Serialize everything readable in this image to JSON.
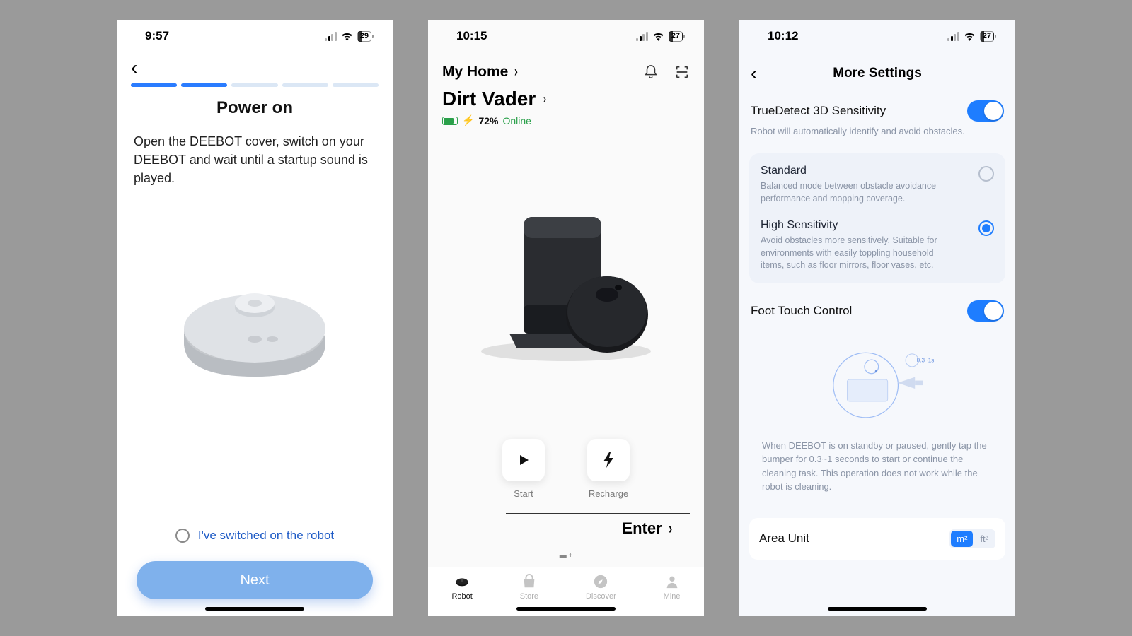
{
  "screen1": {
    "status": {
      "time": "9:57",
      "battery": "29"
    },
    "progress_total": 5,
    "progress_done": 2,
    "title": "Power on",
    "body": "Open the DEEBOT cover, switch on your DEEBOT and wait until a startup sound is played.",
    "checkbox_label": "I've switched on the robot",
    "next_label": "Next"
  },
  "screen2": {
    "status": {
      "time": "10:15",
      "battery": "27"
    },
    "home_label": "My Home",
    "device_name": "Dirt Vader",
    "battery_pct": "72%",
    "charging_prefix": "⚡",
    "online_label": "Online",
    "buttons": {
      "start": "Start",
      "recharge": "Recharge"
    },
    "enter_label": "Enter",
    "tabs": [
      {
        "id": "robot",
        "label": "Robot",
        "active": true
      },
      {
        "id": "store",
        "label": "Store",
        "active": false
      },
      {
        "id": "discover",
        "label": "Discover",
        "active": false
      },
      {
        "id": "mine",
        "label": "Mine",
        "active": false
      }
    ]
  },
  "screen3": {
    "status": {
      "time": "10:12",
      "battery": "27"
    },
    "title": "More Settings",
    "truedetect": {
      "label": "TrueDetect 3D Sensitivity",
      "sub": "Robot will automatically identify and avoid obstacles.",
      "options": [
        {
          "title": "Standard",
          "desc": "Balanced mode between obstacle avoidance performance and mopping coverage.",
          "selected": false
        },
        {
          "title": "High Sensitivity",
          "desc": "Avoid obstacles more sensitively. Suitable for environments with easily toppling household items, such as floor mirrors, floor vases, etc.",
          "selected": true
        }
      ]
    },
    "foottouch": {
      "label": "Foot Touch Control",
      "time_hint": "0.3~1s",
      "desc": "When DEEBOT is on standby or paused, gently tap the bumper for 0.3~1 seconds to start or continue the cleaning task. This operation does not work while the robot is cleaning."
    },
    "area_unit": {
      "label": "Area Unit",
      "options": [
        "m²",
        "ft²"
      ],
      "selected": "m²"
    }
  }
}
